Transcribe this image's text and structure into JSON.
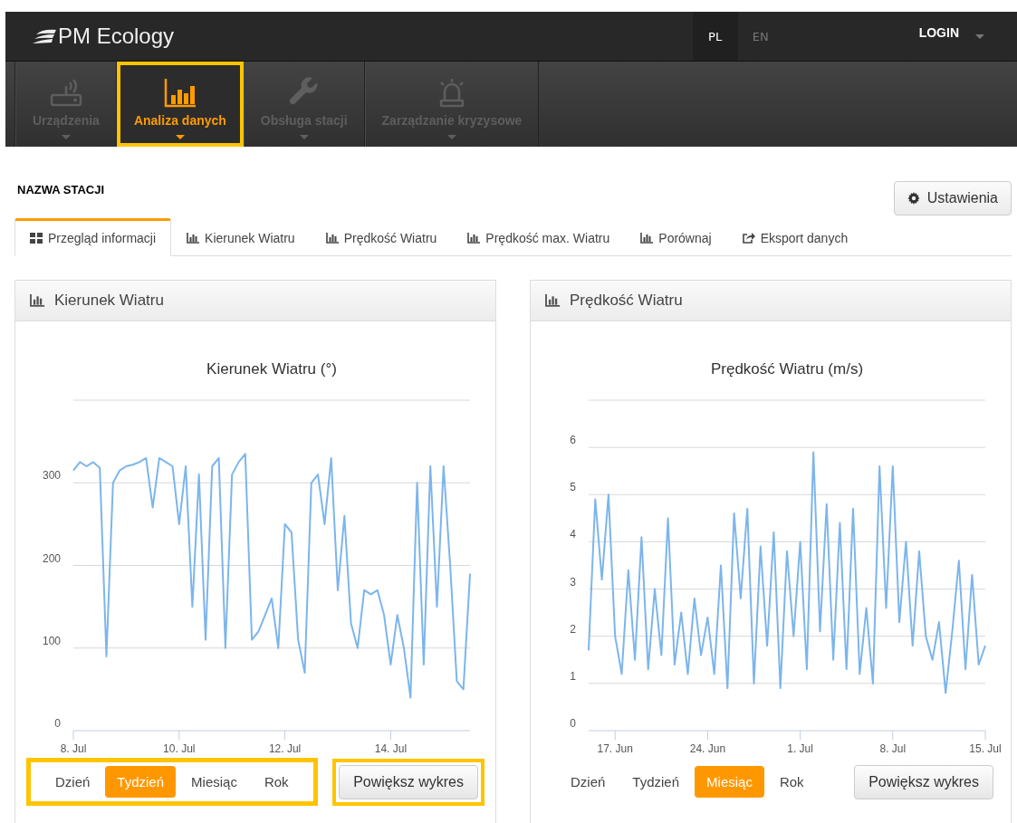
{
  "header": {
    "logo": "PM Ecology",
    "languages": [
      {
        "label": "PL",
        "selected": true
      },
      {
        "label": "EN",
        "selected": false
      }
    ],
    "login": "LOGIN"
  },
  "nav": [
    {
      "label": "Urządzenia",
      "kind": "router",
      "selected": false,
      "highlighted": false
    },
    {
      "label": "Analiza danych",
      "kind": "chart",
      "selected": true,
      "highlighted": true
    },
    {
      "label": "Obsługa stacji",
      "kind": "wrench",
      "selected": false,
      "highlighted": false
    },
    {
      "label": "Zarządzanie kryzysowe",
      "kind": "alarm",
      "selected": false,
      "highlighted": false
    }
  ],
  "station": {
    "title": "NAZWA STACJI",
    "settings_button": "Ustawienia"
  },
  "tabs": [
    {
      "label": "Przegląd informacji",
      "kind": "grid",
      "selected": true
    },
    {
      "label": "Kierunek Wiatru",
      "kind": "chart",
      "selected": false
    },
    {
      "label": "Prędkość Wiatru",
      "kind": "chart",
      "selected": false
    },
    {
      "label": "Prędkość max. Wiatru",
      "kind": "chart",
      "selected": false
    },
    {
      "label": "Porównaj",
      "kind": "chart",
      "selected": false
    },
    {
      "label": "Eksport danych",
      "kind": "export",
      "selected": false
    }
  ],
  "panels": [
    {
      "title": "Kierunek Wiatru",
      "chart_data": {
        "type": "line",
        "title": "Kierunek Wiatru (°)",
        "grid": true,
        "ylim": [
          0,
          400
        ],
        "yticks": [
          0,
          100,
          200,
          300
        ],
        "categories": [
          "8. Jul",
          null,
          null,
          null,
          null,
          null,
          null,
          null,
          null,
          null,
          null,
          null,
          null,
          null,
          null,
          null,
          "10. Jul",
          null,
          null,
          null,
          null,
          null,
          null,
          null,
          null,
          null,
          null,
          null,
          null,
          null,
          null,
          null,
          "12. Jul",
          null,
          null,
          null,
          null,
          null,
          null,
          null,
          null,
          null,
          null,
          null,
          null,
          null,
          null,
          null,
          "14. Jul",
          null,
          null,
          null,
          null,
          null,
          null,
          null,
          null,
          null,
          null,
          null,
          null
        ],
        "series": [
          {
            "color": "#7cb5ec",
            "values": [
              315,
              325,
              320,
              325,
              318,
              90,
              300,
              315,
              320,
              322,
              325,
              330,
              270,
              330,
              325,
              320,
              250,
              320,
              150,
              310,
              110,
              320,
              330,
              100,
              310,
              325,
              335,
              110,
              120,
              140,
              160,
              100,
              250,
              240,
              110,
              70,
              300,
              310,
              250,
              330,
              170,
              260,
              130,
              100,
              170,
              165,
              170,
              140,
              80,
              140,
              100,
              40,
              300,
              80,
              320,
              150,
              320,
              200,
              60,
              50,
              190
            ]
          }
        ]
      },
      "periods": [
        {
          "label": "Dzień",
          "selected": false
        },
        {
          "label": "Tydzień",
          "selected": true
        },
        {
          "label": "Miesiąc",
          "selected": false
        },
        {
          "label": "Rok",
          "selected": false
        }
      ],
      "periods_highlighted": true,
      "zoom_button": {
        "label": "Powiększ wykres",
        "highlighted": true
      }
    },
    {
      "title": "Prędkość Wiatru",
      "chart_data": {
        "type": "line",
        "title": "Prędkość Wiatru (m/s)",
        "grid": true,
        "ylim": [
          0,
          7
        ],
        "yticks": [
          0,
          1,
          2,
          3,
          4,
          5,
          6
        ],
        "categories": [
          null,
          null,
          null,
          null,
          "17. Jun",
          null,
          null,
          null,
          null,
          null,
          null,
          null,
          null,
          null,
          null,
          null,
          null,
          null,
          "24. Jun",
          null,
          null,
          null,
          null,
          null,
          null,
          null,
          null,
          null,
          null,
          null,
          null,
          null,
          "1. Jul",
          null,
          null,
          null,
          null,
          null,
          null,
          null,
          null,
          null,
          null,
          null,
          null,
          null,
          "8. Jul",
          null,
          null,
          null,
          null,
          null,
          null,
          null,
          null,
          null,
          null,
          null,
          null,
          null,
          "15. Jul"
        ],
        "series": [
          {
            "color": "#7cb5ec",
            "values": [
              1.7,
              4.9,
              3.2,
              5.0,
              2.0,
              1.2,
              3.4,
              1.5,
              4.1,
              1.3,
              3.0,
              1.6,
              4.5,
              1.4,
              2.5,
              1.2,
              2.8,
              1.6,
              2.4,
              1.2,
              3.5,
              0.9,
              4.6,
              2.8,
              4.7,
              1.0,
              3.9,
              1.8,
              4.2,
              0.9,
              3.8,
              2.0,
              4.0,
              1.3,
              5.9,
              2.1,
              4.8,
              1.5,
              4.4,
              1.3,
              4.7,
              1.2,
              2.6,
              1.0,
              5.6,
              2.6,
              5.6,
              2.3,
              4.0,
              1.8,
              3.8,
              2.0,
              1.5,
              2.3,
              0.8,
              2.1,
              3.6,
              1.3,
              3.3,
              1.4,
              1.8
            ]
          }
        ]
      },
      "periods": [
        {
          "label": "Dzień",
          "selected": false
        },
        {
          "label": "Tydzień",
          "selected": false
        },
        {
          "label": "Miesiąc",
          "selected": true
        },
        {
          "label": "Rok",
          "selected": false
        }
      ],
      "periods_highlighted": false,
      "zoom_button": {
        "label": "Powiększ wykres",
        "highlighted": false
      }
    }
  ]
}
